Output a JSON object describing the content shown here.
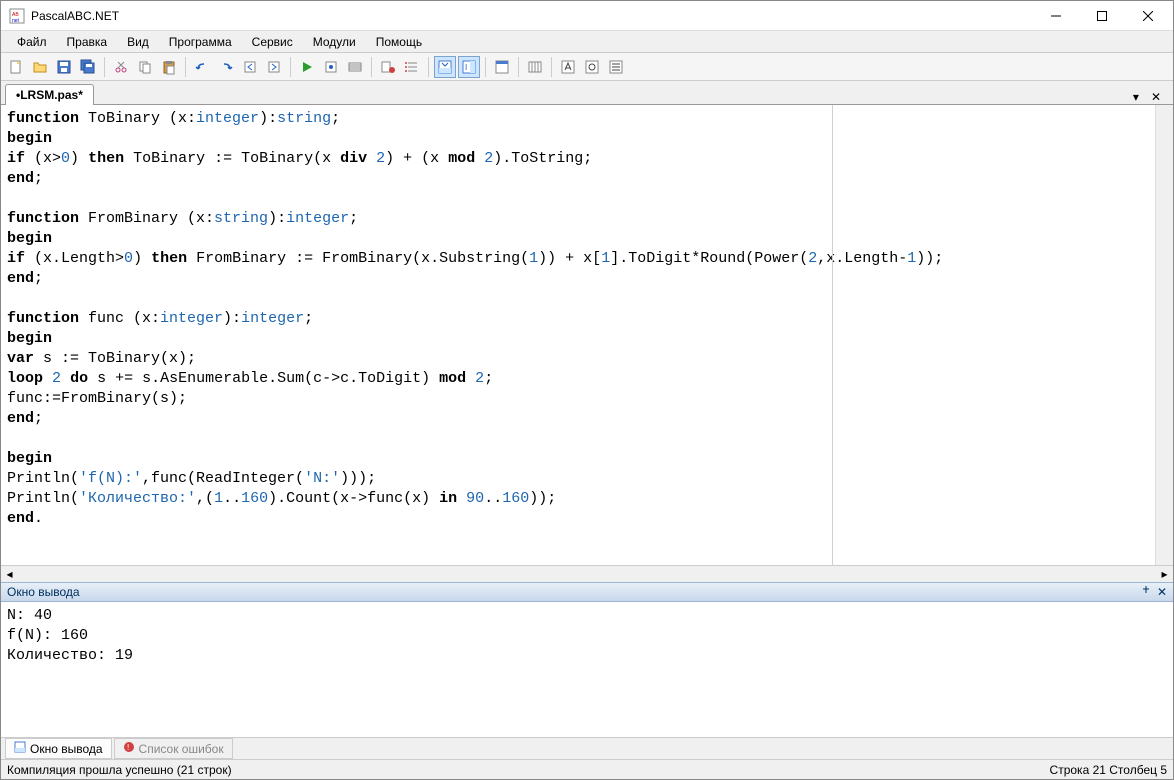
{
  "title": "PascalABC.NET",
  "menus": [
    "Файл",
    "Правка",
    "Вид",
    "Программа",
    "Сервис",
    "Модули",
    "Помощь"
  ],
  "toolbar_icons": [
    "new-file",
    "open-file",
    "save-file",
    "save-all",
    "cut",
    "copy",
    "paste",
    "undo",
    "redo",
    "nav-back",
    "nav-forward",
    "run",
    "step-over",
    "compile",
    "stop",
    "break-toggle",
    "break-all",
    "panel1",
    "panel2",
    "find",
    "options",
    "opt2",
    "opt3",
    "opt4"
  ],
  "tab": {
    "label": "•LRSM.pas*"
  },
  "code": {
    "lines": [
      {
        "t": [
          {
            "c": "kw",
            "s": "function"
          },
          {
            "c": "",
            "s": " ToBinary (x:"
          },
          {
            "c": "type",
            "s": "integer"
          },
          {
            "c": "",
            "s": "):"
          },
          {
            "c": "type",
            "s": "string"
          },
          {
            "c": "",
            "s": ";"
          }
        ]
      },
      {
        "t": [
          {
            "c": "kw",
            "s": "begin"
          }
        ]
      },
      {
        "t": [
          {
            "c": "kw",
            "s": "if"
          },
          {
            "c": "",
            "s": " (x>"
          },
          {
            "c": "num",
            "s": "0"
          },
          {
            "c": "",
            "s": ") "
          },
          {
            "c": "kw",
            "s": "then"
          },
          {
            "c": "",
            "s": " ToBinary := ToBinary(x "
          },
          {
            "c": "kw",
            "s": "div"
          },
          {
            "c": "",
            "s": " "
          },
          {
            "c": "num",
            "s": "2"
          },
          {
            "c": "",
            "s": ") + (x "
          },
          {
            "c": "kw",
            "s": "mod"
          },
          {
            "c": "",
            "s": " "
          },
          {
            "c": "num",
            "s": "2"
          },
          {
            "c": "",
            "s": ").ToString;"
          }
        ]
      },
      {
        "t": [
          {
            "c": "kw",
            "s": "end"
          },
          {
            "c": "",
            "s": ";"
          }
        ]
      },
      {
        "t": [
          {
            "c": "",
            "s": ""
          }
        ]
      },
      {
        "t": [
          {
            "c": "kw",
            "s": "function"
          },
          {
            "c": "",
            "s": " FromBinary (x:"
          },
          {
            "c": "type",
            "s": "string"
          },
          {
            "c": "",
            "s": "):"
          },
          {
            "c": "type",
            "s": "integer"
          },
          {
            "c": "",
            "s": ";"
          }
        ]
      },
      {
        "t": [
          {
            "c": "kw",
            "s": "begin"
          }
        ]
      },
      {
        "t": [
          {
            "c": "kw",
            "s": "if"
          },
          {
            "c": "",
            "s": " (x.Length>"
          },
          {
            "c": "num",
            "s": "0"
          },
          {
            "c": "",
            "s": ") "
          },
          {
            "c": "kw",
            "s": "then"
          },
          {
            "c": "",
            "s": " FromBinary := FromBinary(x.Substring("
          },
          {
            "c": "num",
            "s": "1"
          },
          {
            "c": "",
            "s": ")) + x["
          },
          {
            "c": "num",
            "s": "1"
          },
          {
            "c": "",
            "s": "].ToDigit*Round(Power("
          },
          {
            "c": "num",
            "s": "2"
          },
          {
            "c": "",
            "s": ",x.Length-"
          },
          {
            "c": "num",
            "s": "1"
          },
          {
            "c": "",
            "s": "));"
          }
        ]
      },
      {
        "t": [
          {
            "c": "kw",
            "s": "end"
          },
          {
            "c": "",
            "s": ";"
          }
        ]
      },
      {
        "t": [
          {
            "c": "",
            "s": ""
          }
        ]
      },
      {
        "t": [
          {
            "c": "kw",
            "s": "function"
          },
          {
            "c": "",
            "s": " func (x:"
          },
          {
            "c": "type",
            "s": "integer"
          },
          {
            "c": "",
            "s": "):"
          },
          {
            "c": "type",
            "s": "integer"
          },
          {
            "c": "",
            "s": ";"
          }
        ]
      },
      {
        "t": [
          {
            "c": "kw",
            "s": "begin"
          }
        ]
      },
      {
        "t": [
          {
            "c": "kw",
            "s": "var"
          },
          {
            "c": "",
            "s": " s := ToBinary(x);"
          }
        ]
      },
      {
        "t": [
          {
            "c": "kw",
            "s": "loop"
          },
          {
            "c": "",
            "s": " "
          },
          {
            "c": "num",
            "s": "2"
          },
          {
            "c": "",
            "s": " "
          },
          {
            "c": "kw",
            "s": "do"
          },
          {
            "c": "",
            "s": " s += s.AsEnumerable.Sum(c->c.ToDigit) "
          },
          {
            "c": "kw",
            "s": "mod"
          },
          {
            "c": "",
            "s": " "
          },
          {
            "c": "num",
            "s": "2"
          },
          {
            "c": "",
            "s": ";"
          }
        ]
      },
      {
        "t": [
          {
            "c": "",
            "s": "func:=FromBinary(s);"
          }
        ]
      },
      {
        "t": [
          {
            "c": "kw",
            "s": "end"
          },
          {
            "c": "",
            "s": ";"
          }
        ]
      },
      {
        "t": [
          {
            "c": "",
            "s": ""
          }
        ]
      },
      {
        "t": [
          {
            "c": "kw",
            "s": "begin"
          }
        ]
      },
      {
        "t": [
          {
            "c": "",
            "s": "Println("
          },
          {
            "c": "str",
            "s": "'f(N):'"
          },
          {
            "c": "",
            "s": ",func(ReadInteger("
          },
          {
            "c": "str",
            "s": "'N:'"
          },
          {
            "c": "",
            "s": ")));"
          }
        ]
      },
      {
        "t": [
          {
            "c": "",
            "s": "Println("
          },
          {
            "c": "str",
            "s": "'Количество:'"
          },
          {
            "c": "",
            "s": ",("
          },
          {
            "c": "num",
            "s": "1"
          },
          {
            "c": "",
            "s": ".."
          },
          {
            "c": "num",
            "s": "160"
          },
          {
            "c": "",
            "s": ").Count(x->func(x) "
          },
          {
            "c": "kw",
            "s": "in"
          },
          {
            "c": "",
            "s": " "
          },
          {
            "c": "num",
            "s": "90"
          },
          {
            "c": "",
            "s": ".."
          },
          {
            "c": "num",
            "s": "160"
          },
          {
            "c": "",
            "s": "));"
          }
        ]
      },
      {
        "t": [
          {
            "c": "kw",
            "s": "end"
          },
          {
            "c": "",
            "s": "."
          }
        ]
      }
    ]
  },
  "output_panel": {
    "title": "Окно вывода",
    "lines": [
      "N: 40",
      "f(N): 160",
      "Количество: 19"
    ]
  },
  "bottom_tabs": [
    {
      "label": "Окно вывода",
      "active": true
    },
    {
      "label": "Список ошибок",
      "active": false
    }
  ],
  "status": {
    "left": "Компиляция прошла успешно (21 строк)",
    "right": "Строка  21  Столбец  5"
  }
}
